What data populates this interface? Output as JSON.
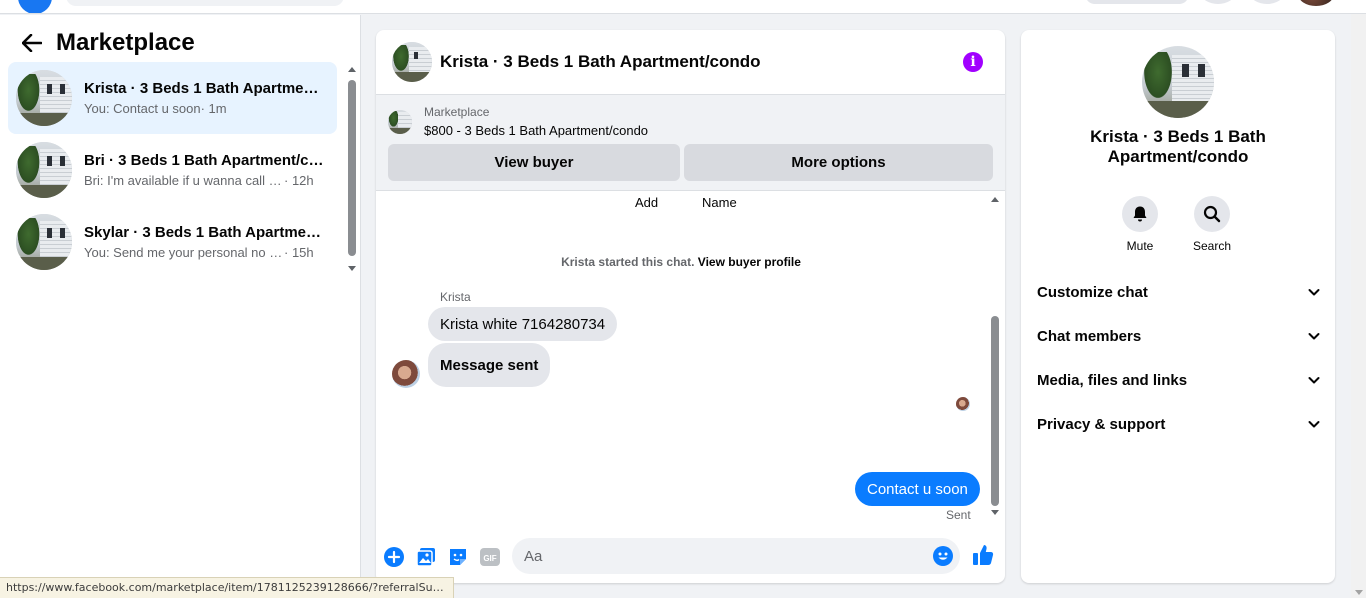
{
  "sidebar": {
    "title": "Marketplace",
    "conversations": [
      {
        "title": "Krista · 3 Beds 1 Bath Apartment/condo",
        "snippet": "You: Contact u soon",
        "time": "· 1m"
      },
      {
        "title": "Bri · 3 Beds 1 Bath Apartment/condo",
        "snippet": "Bri: I'm available if u wanna call n...",
        "time": "· 12h"
      },
      {
        "title": "Skylar · 3 Beds 1 Bath Apartment/condo",
        "snippet": "You: Send me your personal no I ...",
        "time": "· 15h"
      }
    ]
  },
  "chat": {
    "title": "Krista · 3 Beds 1 Bath Apartment/condo",
    "listing": {
      "label": "Marketplace",
      "price_title": "$800 - 3 Beds 1 Bath Apartment/condo"
    },
    "buttons": {
      "view_buyer": "View buyer",
      "more_options": "More options"
    },
    "cut_row": {
      "add": "Add",
      "name": "Name"
    },
    "started_text": "Krista started this chat.",
    "view_profile": "View buyer profile",
    "sender_name": "Krista",
    "messages_in": [
      "Krista white 7164280734",
      "Message sent"
    ],
    "message_out": "Contact u soon",
    "sent_label": "Sent",
    "composer_placeholder": "Aa"
  },
  "right_panel": {
    "name": "Krista · 3 Beds 1 Bath Apartment/condo",
    "actions": [
      {
        "label": "Mute",
        "icon": "bell-icon"
      },
      {
        "label": "Search",
        "icon": "search-icon"
      }
    ],
    "sections": [
      "Customize chat",
      "Chat members",
      "Media, files and links",
      "Privacy & support"
    ]
  },
  "status_url": "https://www.facebook.com/marketplace/item/1781125239128666/?referralSurfac...",
  "colors": {
    "accent": "#0a7cff",
    "info": "#a100ff",
    "active_bg": "#e7f3ff"
  }
}
